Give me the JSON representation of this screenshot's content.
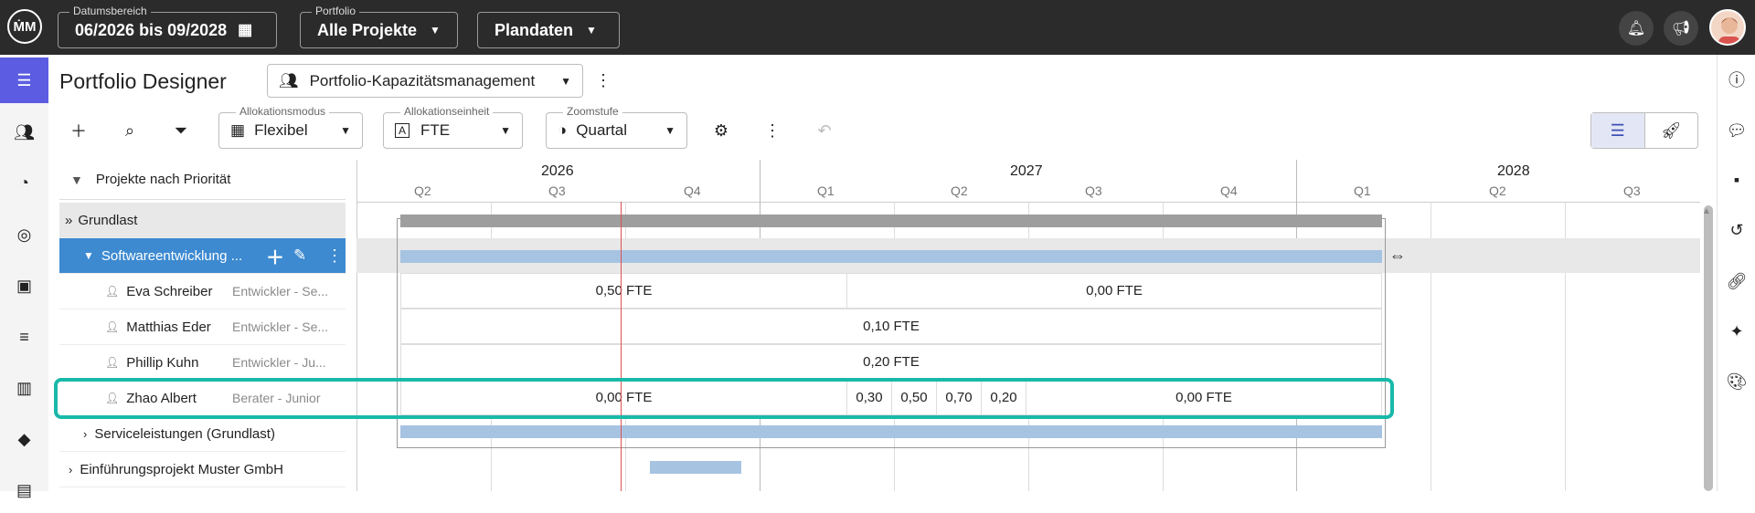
{
  "topbar": {
    "logo": "ṀM",
    "date_range_label": "Datumsbereich",
    "date_range_value": "06/2026 bis 09/2028",
    "portfolio_label": "Portfolio",
    "portfolio_value": "Alle Projekte",
    "data_value": "Plandaten",
    "icons": [
      "calendar-icon",
      "bell-icon",
      "megaphone-icon",
      "avatar"
    ]
  },
  "header": {
    "title": "Portfolio Designer",
    "view_select": "Portfolio-Kapazitätsmanagement"
  },
  "toolbar": {
    "allocation_mode_label": "Allokationsmodus",
    "allocation_mode_value": "Flexibel",
    "allocation_unit_label": "Allokationseinheit",
    "allocation_unit_value": "FTE",
    "zoom_label": "Zoomstufe",
    "zoom_value": "Quartal"
  },
  "tree": {
    "header": "Projekte nach Priorität",
    "group": "Grundlast",
    "project_selected": "Softwareentwicklung ...",
    "resources": [
      {
        "name": "Eva Schreiber",
        "role": "Entwickler - Se..."
      },
      {
        "name": "Matthias Eder",
        "role": "Entwickler - Se..."
      },
      {
        "name": "Phillip Kuhn",
        "role": "Entwickler - Ju..."
      },
      {
        "name": "Zhao Albert",
        "role": "Berater - Junior"
      }
    ],
    "project_2": "Serviceleistungen (Grundlast)",
    "project_3": "Einführungsprojekt Muster GmbH"
  },
  "gantt": {
    "years": [
      "2026",
      "2027",
      "2028"
    ],
    "quarters": [
      "Q2",
      "Q3",
      "Q4",
      "Q1",
      "Q2",
      "Q3",
      "Q4",
      "Q1",
      "Q2",
      "Q3"
    ],
    "rows": {
      "eva": [
        "0,50 FTE",
        "0,00 FTE"
      ],
      "matthias": [
        "0,10 FTE"
      ],
      "phillip": [
        "0,20 FTE"
      ],
      "zhao": [
        "0,00 FTE",
        "0,30",
        "0,50",
        "0,70",
        "0,20",
        "0,00 FTE"
      ]
    },
    "colors": {
      "group_bar": "#9e9e9e",
      "project_bar": "#a7c3e2",
      "today_line": "#e05050",
      "highlight": "#19b9aa",
      "selected_row": "#3d8ad1"
    }
  }
}
